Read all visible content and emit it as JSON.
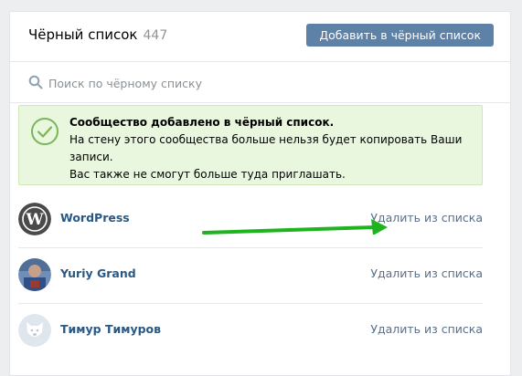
{
  "header": {
    "title": "Чёрный список",
    "count": "447",
    "add_button": "Добавить в чёрный список"
  },
  "search": {
    "placeholder": "Поиск по чёрному списку"
  },
  "notice": {
    "title": "Сообщество добавлено в чёрный список.",
    "line1": "На стену этого сообщества больше нельзя будет копировать Ваши записи.",
    "line2": "Вас также не смогут больше туда приглашать."
  },
  "list": [
    {
      "name": "WordPress",
      "action": "Удалить из списка",
      "avatar_icon": "wordpress-logo-icon"
    },
    {
      "name": "Yuriy Grand",
      "action": "Удалить из списка",
      "avatar_icon": "user-photo"
    },
    {
      "name": "Тимур Тимуров",
      "action": "Удалить из списка",
      "avatar_icon": "default-dog-avatar-icon"
    }
  ],
  "colors": {
    "button": "#5e81a8",
    "link": "#2a5885",
    "notice_bg": "#e9f7df",
    "arrow": "#1fb31f"
  }
}
